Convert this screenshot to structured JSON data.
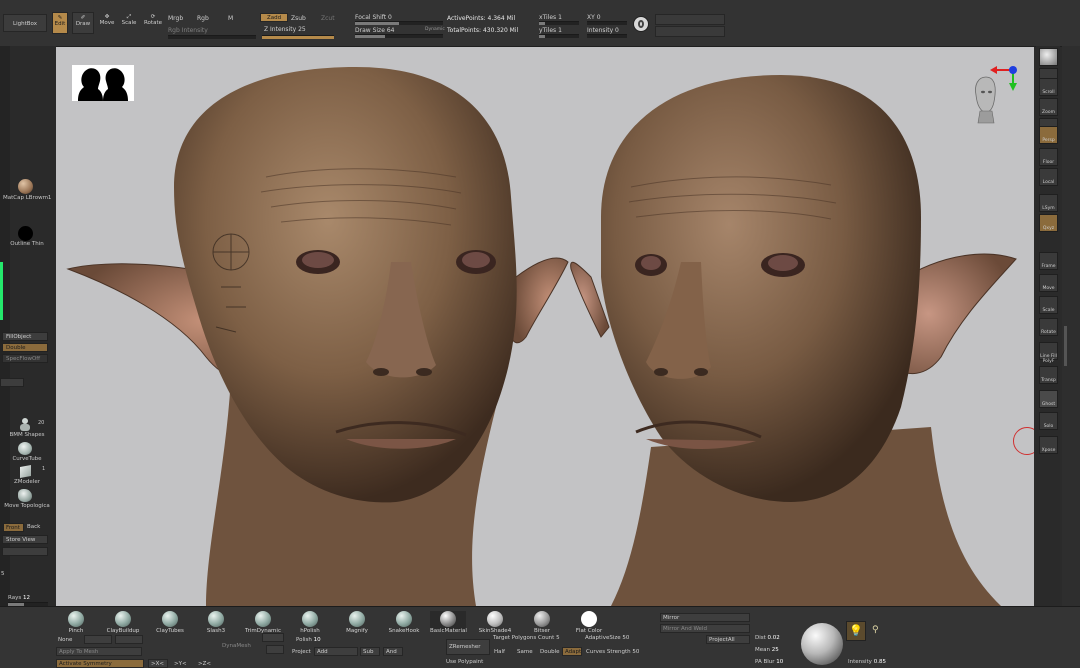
{
  "top": {
    "lightbox": "LightBox",
    "edit": "Edit",
    "draw": "Draw",
    "move": "Move",
    "scale": "Scale",
    "rotate": "Rotate",
    "mrgb": "Mrgb",
    "rgb": "Rgb",
    "m": "M",
    "rgb_intensity": "Rgb Intensity",
    "zadd": "Zadd",
    "zsub": "Zsub",
    "zcut": "Zcut",
    "z_intensity_label": "Z Intensity",
    "z_intensity_value": "25",
    "focal_shift_label": "Focal Shift",
    "focal_shift_value": "0",
    "draw_size_label": "Draw Size",
    "draw_size_value": "64",
    "dynamic": "Dynamic",
    "active_points": "ActivePoints: 4.364 Mil",
    "total_points": "TotalPoints: 430.320 Mil",
    "xtiles_label": "xTiles",
    "xtiles_value": "1",
    "ytiles_label": "yTiles",
    "ytiles_value": "1",
    "xy_label": "XY",
    "xy_value": "0",
    "intensity_label": "Intensity",
    "intensity_value": "0"
  },
  "left": {
    "matcap_label": "MatCap LBrowm1",
    "outline_label": "Outline Thin",
    "fillobject": "FillObject",
    "double": "Double",
    "spec": "SpecFlowOff",
    "tool_count": "20",
    "tools": [
      "BMM Shapes",
      "CurveTube",
      "ZModeler",
      "Move Topologica"
    ],
    "zmodeler_count": "1",
    "front": "Front",
    "back": "Back",
    "store_view": "Store View",
    "left_number": "5",
    "rays_label": "Rays",
    "rays_value": "12"
  },
  "right": {
    "buttons": [
      "",
      "SPix 3",
      "Scroll",
      "Zoom",
      "Actual",
      "Persp",
      "Floor",
      "Local",
      "LSym",
      "Qxyz",
      "",
      "",
      "Frame",
      "Move",
      "Scale",
      "Rotate",
      "Line Fill PolyF",
      "Transp",
      "Ghost",
      "Solo",
      "Xpose"
    ]
  },
  "bottom": {
    "brushes": [
      "Pinch",
      "ClayBuildup",
      "ClayTubes",
      "Slash3",
      "TrimDynamic",
      "hPolish",
      "Magnify",
      "SnakeHook",
      "BasicMaterial",
      "SkinShade4",
      "Bitser",
      "Flat Color"
    ],
    "none": "None",
    "polish_label": "Polish",
    "polish_value": "10",
    "project": "Project",
    "add": "Add",
    "sub": "Sub",
    "and": "And",
    "zremesher": "ZRemesher",
    "half": "Half",
    "same": "Same",
    "double": "Double",
    "adapt": "Adapt",
    "target_polygons": "Target Polygons Count 5",
    "adaptive_size": "AdaptiveSize 50",
    "curves_strength": "Curves Strength 50",
    "use_polypaint": "Use Polypaint",
    "mirror": "Mirror",
    "mirror_and_weld": "Mirror And Weld",
    "project_all": "ProjectAll",
    "dist_label": "Dist",
    "dist_value": "0.02",
    "mean_label": "Mean",
    "mean_value": "25",
    "pa_blur_label": "PA Blur",
    "pa_blur_value": "10",
    "intensity_label": "Intensity",
    "intensity_value": "0.85",
    "activate_symmetry": "Activate Symmetry",
    "x": ">X<",
    "y": ">Y<",
    "z": ">Z<",
    "apply_to_mesh": "Apply To Mesh"
  },
  "colors": {
    "accent": "#b58a4a",
    "viewport_bg": "#c3c3c5",
    "panel": "#333333",
    "skin": "#8a6a4e"
  }
}
